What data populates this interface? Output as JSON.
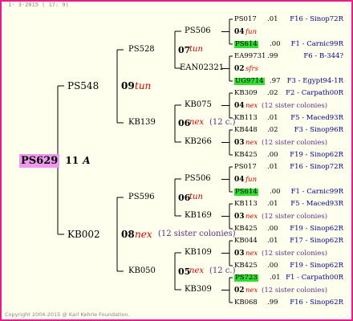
{
  "header": "1- 3-2015 ( 17: 9)",
  "footer": "Copyright 2004-2015 @ Karl Kehrle Foundation.",
  "root": {
    "id": "PS629",
    "year": "11",
    "mark": "A"
  },
  "gen1": [
    {
      "id": "PS548",
      "year": "09",
      "mark": "tun"
    },
    {
      "id": "KB002",
      "year": "08",
      "mark": "nex",
      "sisters": "(12 sister colonies)"
    }
  ],
  "gen2": [
    {
      "id": "PS528",
      "year": "07",
      "mark": "tun"
    },
    {
      "id": "KB139",
      "year": "06",
      "mark": "nex",
      "sisters": "(12 c.)"
    },
    {
      "id": "PS596",
      "year": "06",
      "mark": "tun"
    },
    {
      "id": "KB050",
      "year": "05",
      "mark": "nex",
      "sisters": "(12 c.)"
    }
  ],
  "gen3": [
    {
      "id": "PS506",
      "year": "04",
      "mark": "fun"
    },
    {
      "id": "EAN02321",
      "year": "02",
      "mark": "sfrs"
    },
    {
      "id": "KB075",
      "year": "04",
      "mark": "nex",
      "sisters": "(12 sister colonies)"
    },
    {
      "id": "KB266",
      "year": "03",
      "mark": "nex",
      "sisters": "(12 sister colonies)"
    },
    {
      "id": "PS506",
      "year": "04",
      "mark": "fun"
    },
    {
      "id": "KB169",
      "year": "03",
      "mark": "nex",
      "sisters": "(12 sister colonies)"
    },
    {
      "id": "KB109",
      "year": "03",
      "mark": "nex",
      "sisters": "(12 sister colonies)"
    },
    {
      "id": "KB309",
      "year": "02",
      "mark": "nex",
      "sisters": "(12 sister colonies)"
    }
  ],
  "gen4": [
    {
      "id": "PS017",
      "year": ".01",
      "src": "F16 - Sinop72R",
      "hl": false
    },
    {
      "id": "PS614",
      "year": ".00",
      "src": "F1 - Carnic99R",
      "hl": true
    },
    {
      "id": "EA99731",
      "year": ".99",
      "src": "F6 - B-344?",
      "hl": false
    },
    {
      "id": "UG9714",
      "year": ".97",
      "src": "F3 - Egypt94-1R",
      "hl": true
    },
    {
      "id": "KB309",
      "year": ".02",
      "src": "F2 - Carpath00R",
      "hl": false
    },
    {
      "id": "KB113",
      "year": ".01",
      "src": "F5 - Maced93R",
      "hl": false
    },
    {
      "id": "KB448",
      "year": ".02",
      "src": "F3 - Sinop96R",
      "hl": false
    },
    {
      "id": "KB425",
      "year": ".00",
      "src": "F19 - Sinop62R",
      "hl": false
    },
    {
      "id": "PS017",
      "year": ".01",
      "src": "F16 - Sinop72R",
      "hl": false
    },
    {
      "id": "PS614",
      "year": ".00",
      "src": "F1 - Carnic99R",
      "hl": true
    },
    {
      "id": "KB113",
      "year": ".01",
      "src": "F5 - Maced93R",
      "hl": false
    },
    {
      "id": "KB425",
      "year": ".00",
      "src": "F19 - Sinop62R",
      "hl": false
    },
    {
      "id": "KB044",
      "year": ".01",
      "src": "F17 - Sinop62R",
      "hl": false
    },
    {
      "id": "KB425",
      "year": ".00",
      "src": "F19 - Sinop62R",
      "hl": false
    },
    {
      "id": "PS723",
      "year": ".01",
      "src": "F1 - Carpath00R",
      "hl": true
    },
    {
      "id": "KB068",
      "year": ".99",
      "src": "F16 - Sinop62R",
      "hl": false
    }
  ]
}
